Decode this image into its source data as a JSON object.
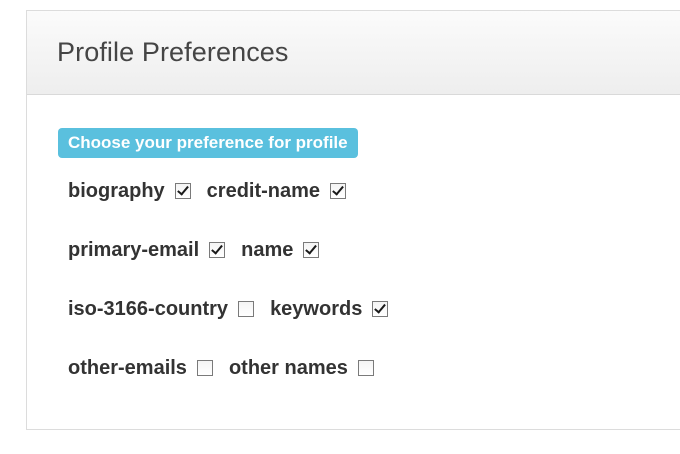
{
  "panel": {
    "title": "Profile Preferences"
  },
  "badge": {
    "text": "Choose your preference for profile",
    "color": "#5ac0de"
  },
  "preferences": [
    {
      "label": "biography",
      "checked": true
    },
    {
      "label": "credit-name",
      "checked": true
    },
    {
      "label": "primary-email",
      "checked": true
    },
    {
      "label": "name",
      "checked": true
    },
    {
      "label": "iso-3166-country",
      "checked": false
    },
    {
      "label": "keywords",
      "checked": true
    },
    {
      "label": "other-emails",
      "checked": false
    },
    {
      "label": "other names",
      "checked": false
    }
  ]
}
